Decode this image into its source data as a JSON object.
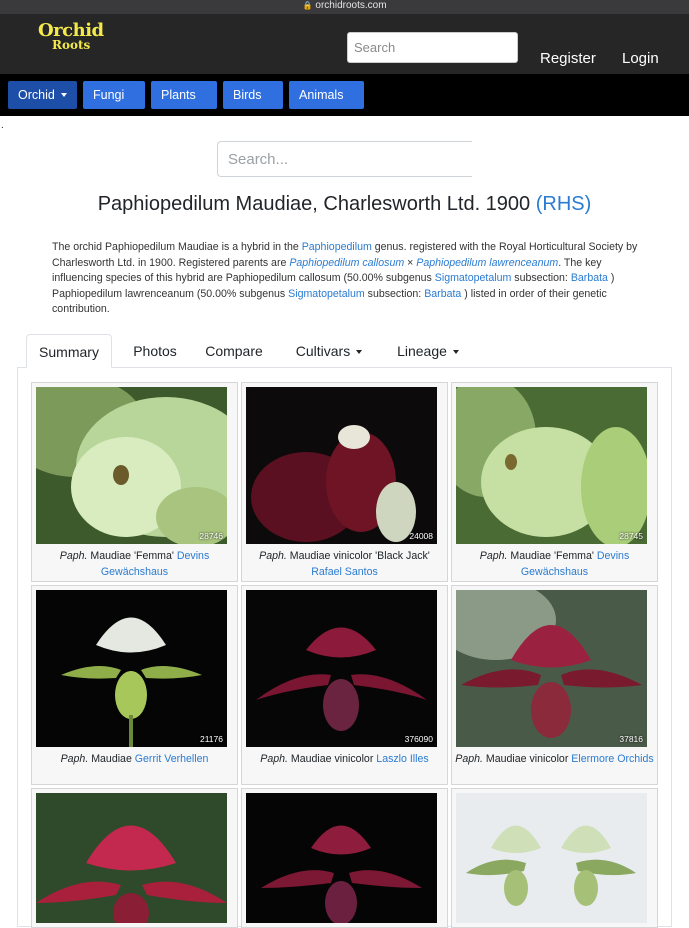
{
  "browser": {
    "url": "orchidroots.com"
  },
  "header": {
    "logo_line1": "Orchid",
    "logo_line2": "Roots",
    "search_placeholder": "Search",
    "register": "Register",
    "login": "Login"
  },
  "categories": [
    "Orchid",
    "Fungi",
    "Plants",
    "Birds",
    "Animals"
  ],
  "main": {
    "search_placeholder": "Search...",
    "title": "Paphiopedilum Maudiae, Charlesworth Ltd. 1900",
    "title_link": "(RHS)",
    "desc": {
      "t1": "The orchid Paphiopedilum Maudiae is a hybrid in the ",
      "genus": "Paphiopedilum",
      "t2": " genus. registered with the Royal Horticultural Society by Charlesworth Ltd. in 1900. Registered parents are ",
      "parent1": "Paphiopedilum callosum",
      "t3": " × ",
      "parent2": "Paphiopedilum lawrenceanum",
      "t4": ". The key influencing species of this hybrid are Paphiopedilum callosum (50.00% subgenus ",
      "subgenus1": "Sigmatopetalum",
      "t5": " subsection: ",
      "subsection1": "Barbata",
      "t6": " ) Paphiopedilum lawrenceanum (50.00% subgenus ",
      "subgenus2": "Sigmatopetalum",
      "t7": " subsection: ",
      "subsection2": "Barbata",
      "t8": " ) listed in order of their genetic contribution."
    }
  },
  "tabs": [
    "Summary",
    "Photos",
    "Compare",
    "Cultivars",
    "Lineage"
  ],
  "cards": [
    {
      "genus_abbr": "Paph.",
      "name": " Maudiae 'Femma' ",
      "credit": "Devins Gewächshaus",
      "photo_id": "28746"
    },
    {
      "genus_abbr": "Paph.",
      "name": " Maudiae vinicolor 'Black Jack' ",
      "credit": "Rafael Santos",
      "photo_id": "24008"
    },
    {
      "genus_abbr": "Paph.",
      "name": " Maudiae 'Femma' ",
      "credit": "Devins Gewächshaus",
      "photo_id": "28745"
    },
    {
      "genus_abbr": "Paph.",
      "name": " Maudiae ",
      "credit": "Gerrit Verhellen",
      "photo_id": "21176"
    },
    {
      "genus_abbr": "Paph.",
      "name": " Maudiae vinicolor ",
      "credit": "Laszlo Illes",
      "photo_id": "376090"
    },
    {
      "genus_abbr": "Paph.",
      "name": " Maudiae vinicolor ",
      "credit": "Elermore Orchids",
      "photo_id": "37816"
    }
  ],
  "colors": {
    "link": "#2a7bd1",
    "nav_button": "#2f6fe0",
    "header_bg": "#262626",
    "logo": "#f4e94b"
  }
}
